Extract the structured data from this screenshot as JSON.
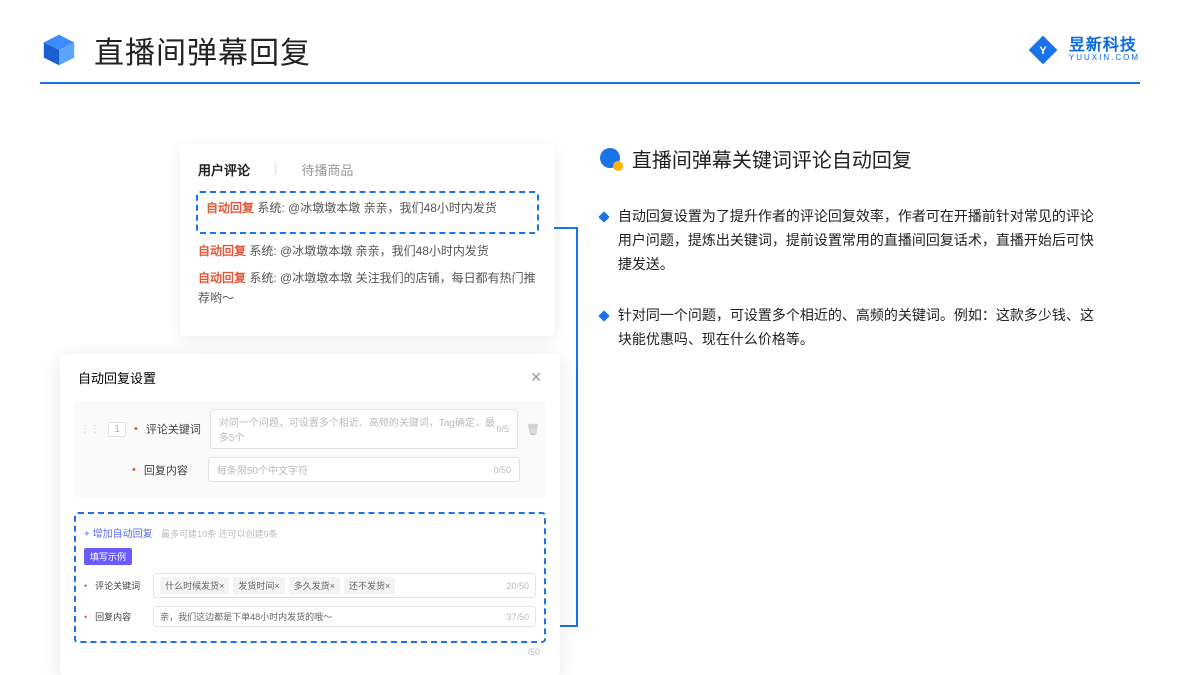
{
  "header": {
    "title": "直播间弹幕回复",
    "brand_name": "昱新科技",
    "brand_sub": "YUUXIN.COM"
  },
  "comments": {
    "tab_active": "用户评论",
    "tab_inactive": "待播商品",
    "auto_tag": "自动回复",
    "sys_label": "系统:",
    "row1": "@冰墩墩本墩 亲亲，我们48小时内发货",
    "row2": "@冰墩墩本墩 亲亲，我们48小时内发货",
    "row3": "@冰墩墩本墩 关注我们的店铺，每日都有热门推荐哟～"
  },
  "settings": {
    "title": "自动回复设置",
    "idx": "1",
    "field_keyword_label": "评论关键词",
    "field_keyword_placeholder": "对同一个问题，可设置多个相近、高频的关键词，Tag确定，最多5个",
    "field_keyword_count": "0/5",
    "field_reply_label": "回复内容",
    "field_reply_placeholder": "每条限50个中文字符",
    "field_reply_count": "0/50",
    "add_link": "+ 增加自动回复",
    "add_note": "最多可建10条 还可以创建9条",
    "example_badge": "填写示例",
    "ex_keyword_label": "评论关键词",
    "ex_tags": [
      "什么时候发货×",
      "发货时间×",
      "多久发货×",
      "还不发货×"
    ],
    "ex_keyword_count": "20/50",
    "ex_reply_label": "回复内容",
    "ex_reply_value": "亲，我们这边都是下单48小时内发货的哦～",
    "ex_reply_count": "37/50",
    "trail_count": "/50"
  },
  "right": {
    "section_title": "直播间弹幕关键词评论自动回复",
    "bullet1": "自动回复设置为了提升作者的评论回复效率，作者可在开播前针对常见的评论用户问题，提炼出关键词，提前设置常用的直播间回复话术，直播开始后可快捷发送。",
    "bullet2": "针对同一个问题，可设置多个相近的、高频的关键词。例如：这款多少钱、这块能优惠吗、现在什么价格等。"
  }
}
